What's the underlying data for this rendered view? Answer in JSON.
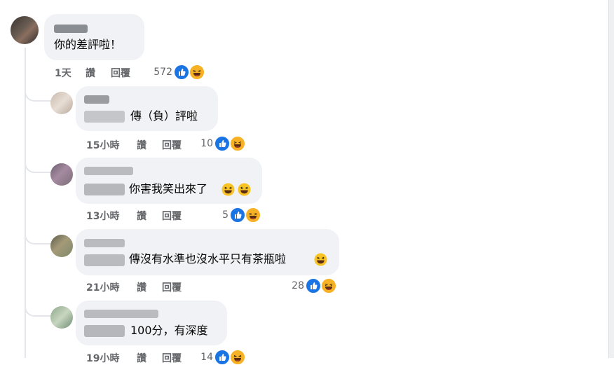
{
  "comments": [
    {
      "text": "你的差評啦！",
      "time": "1天",
      "like_label": "讚",
      "reply_label": "回覆",
      "reactions": "572"
    },
    {
      "text": "傳（負）評啦",
      "time": "15小時",
      "like_label": "讚",
      "reply_label": "回覆",
      "reactions": "10"
    },
    {
      "text": "你害我笑出來了",
      "time": "13小時",
      "like_label": "讚",
      "reply_label": "回覆",
      "reactions": "5"
    },
    {
      "text": "傳沒有水準也沒水平只有茶瓶啦",
      "time": "21小時",
      "like_label": "讚",
      "reply_label": "回覆",
      "reactions": "28"
    },
    {
      "text": "100分，有深度",
      "time": "19小時",
      "like_label": "讚",
      "reply_label": "回覆",
      "reactions": "14"
    }
  ],
  "icons": {
    "like": "thumbs-up-icon",
    "haha": "laughing-face-icon",
    "emoji": "grinning-squinting-face-icon"
  },
  "colors": {
    "bubble": "#f0f2f5",
    "like": "#1b74e4",
    "haha": "#f7b125",
    "meta_text": "#65676b"
  }
}
